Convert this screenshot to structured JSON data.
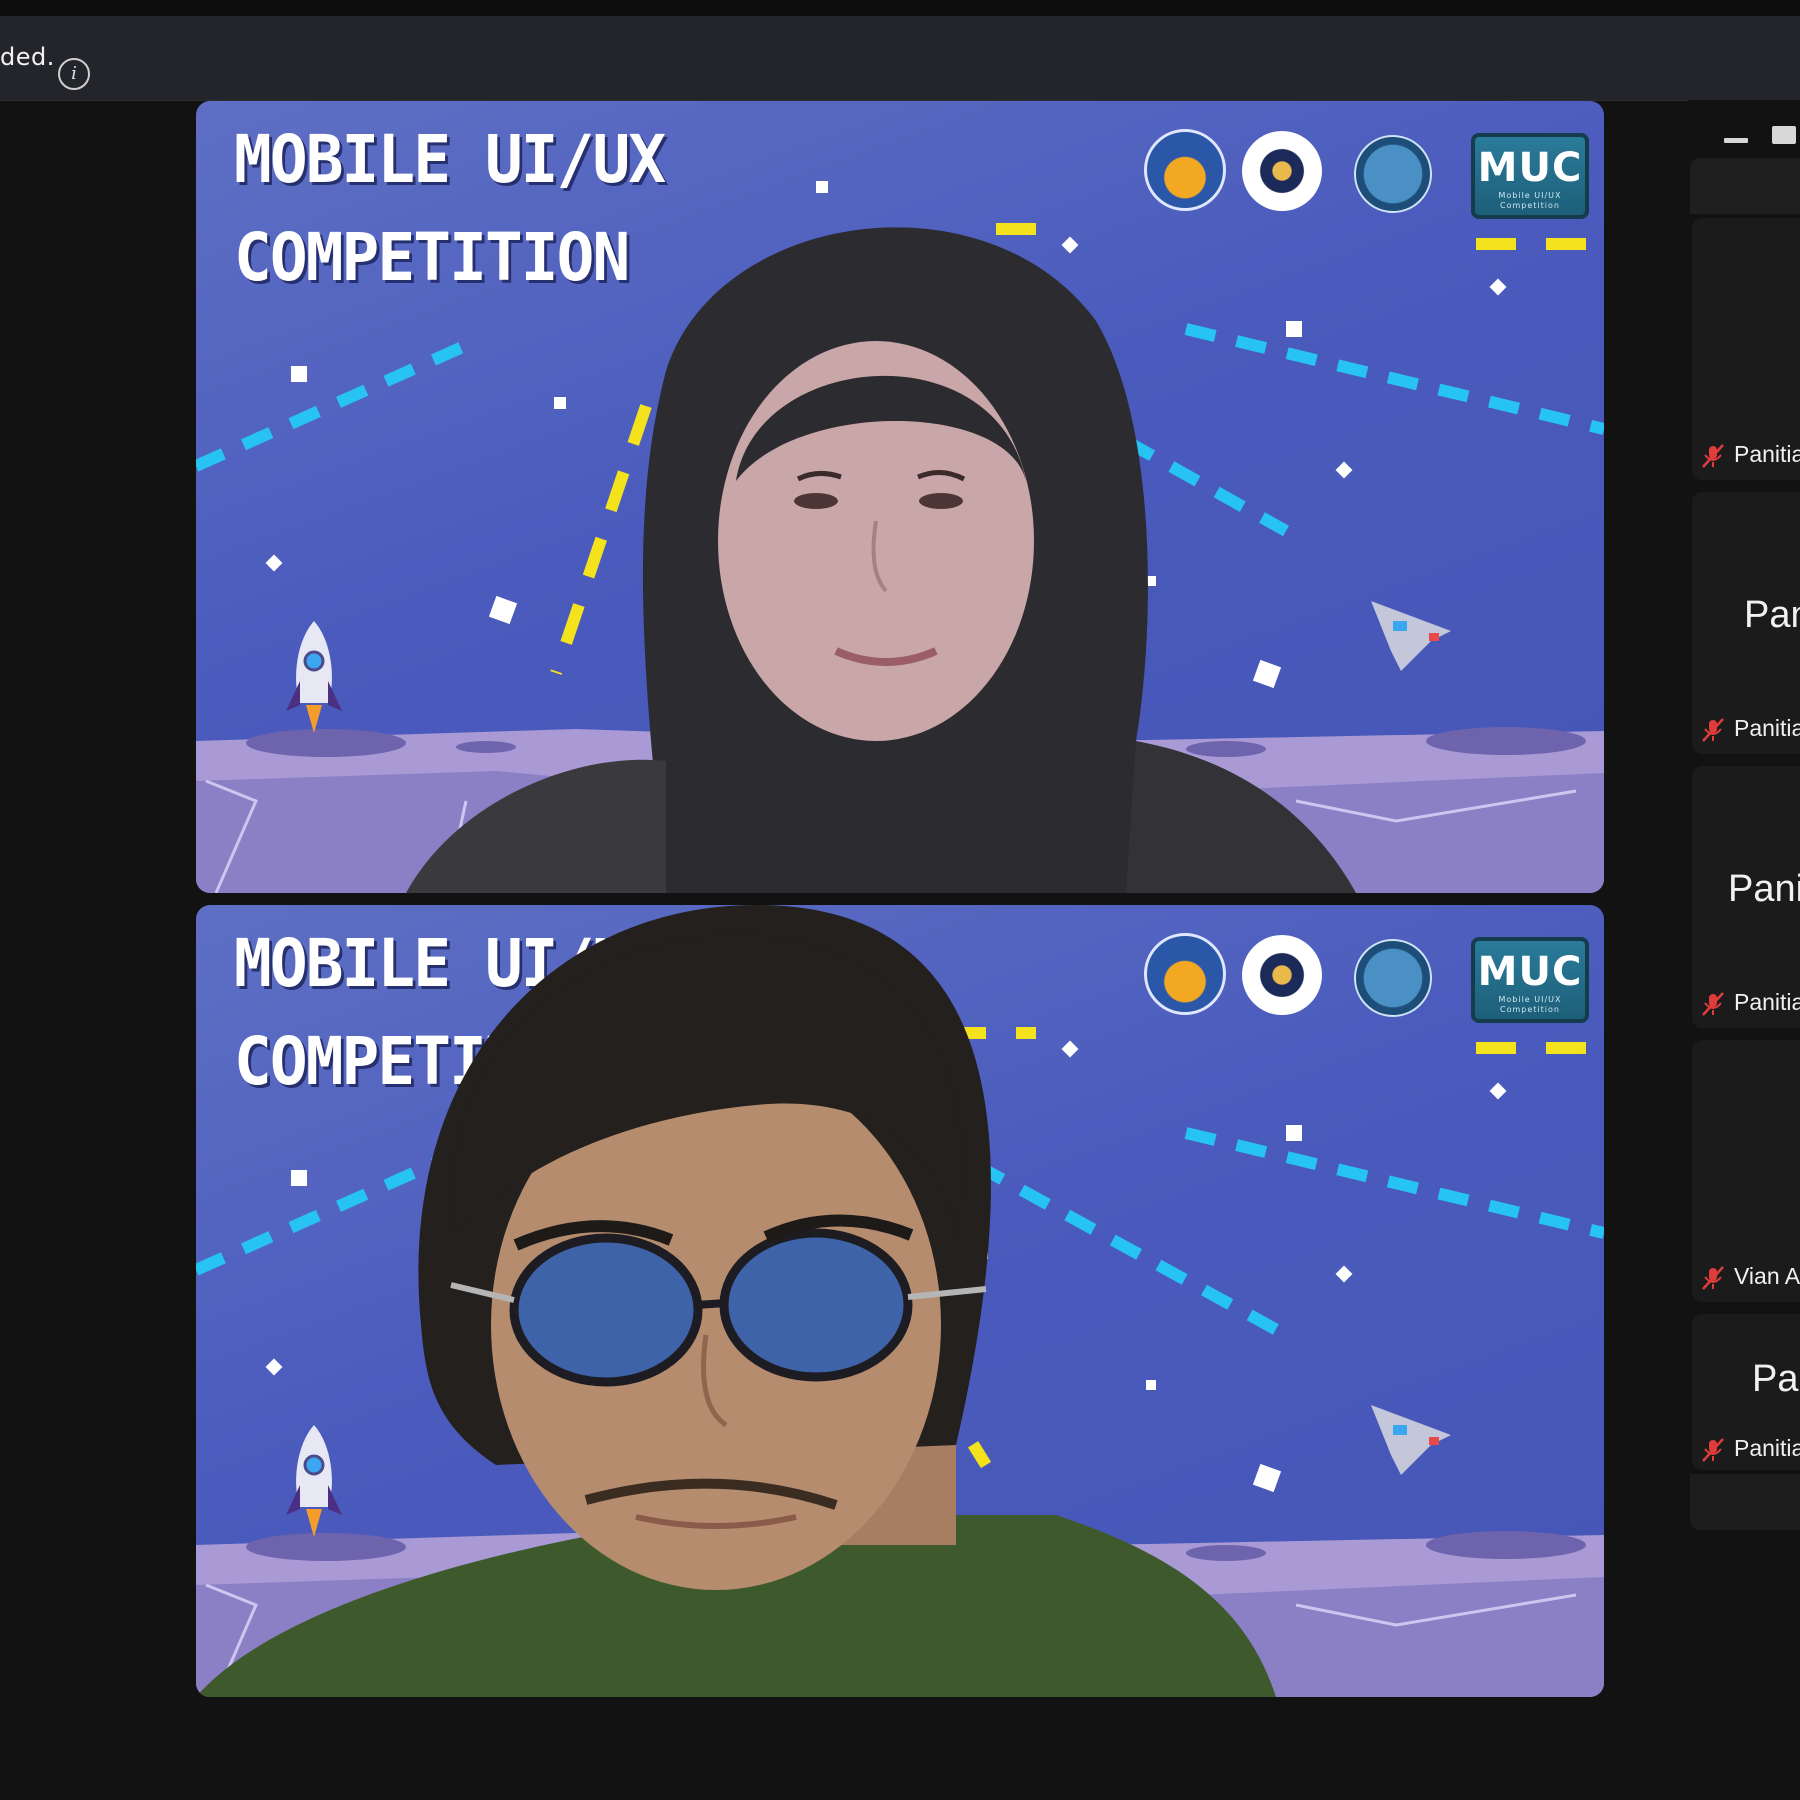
{
  "banner": {
    "text": "ded.",
    "info_icon": "info-circle-icon"
  },
  "video_tiles": [
    {
      "title_line1": "MOBILE UI/UX",
      "title_line2": "COMPETITION",
      "logos": [
        "university-logo",
        "gear-emblem-logo",
        "fest-logo"
      ],
      "muc_logo": "MUC",
      "muc_sub": "Mobile UI/UX Competition"
    },
    {
      "title_line1": "MOBILE UI/UX",
      "title_line2": "COMPETITION",
      "logos": [
        "university-logo",
        "gear-emblem-logo",
        "fest-logo"
      ],
      "muc_logo": "MUC",
      "muc_sub": "Mobile UI/UX Competition"
    }
  ],
  "sidebar": {
    "controls": [
      "minimize-icon",
      "maximize-icon"
    ],
    "participants": [
      {
        "center": "",
        "footer": "Panitia",
        "muted": true
      },
      {
        "center": "Panitia",
        "footer": "Panitia",
        "muted": true
      },
      {
        "center": "Panitia",
        "footer": "Panitia",
        "muted": true
      },
      {
        "center": "",
        "footer": "Vian A",
        "muted": true
      },
      {
        "center": "Panitia",
        "footer": "Panitia",
        "muted": true
      }
    ]
  },
  "colors": {
    "background": "#121212",
    "banner": "#23252a",
    "tile_bg": "#4b5bbd",
    "mute_red": "#e03c3c"
  }
}
